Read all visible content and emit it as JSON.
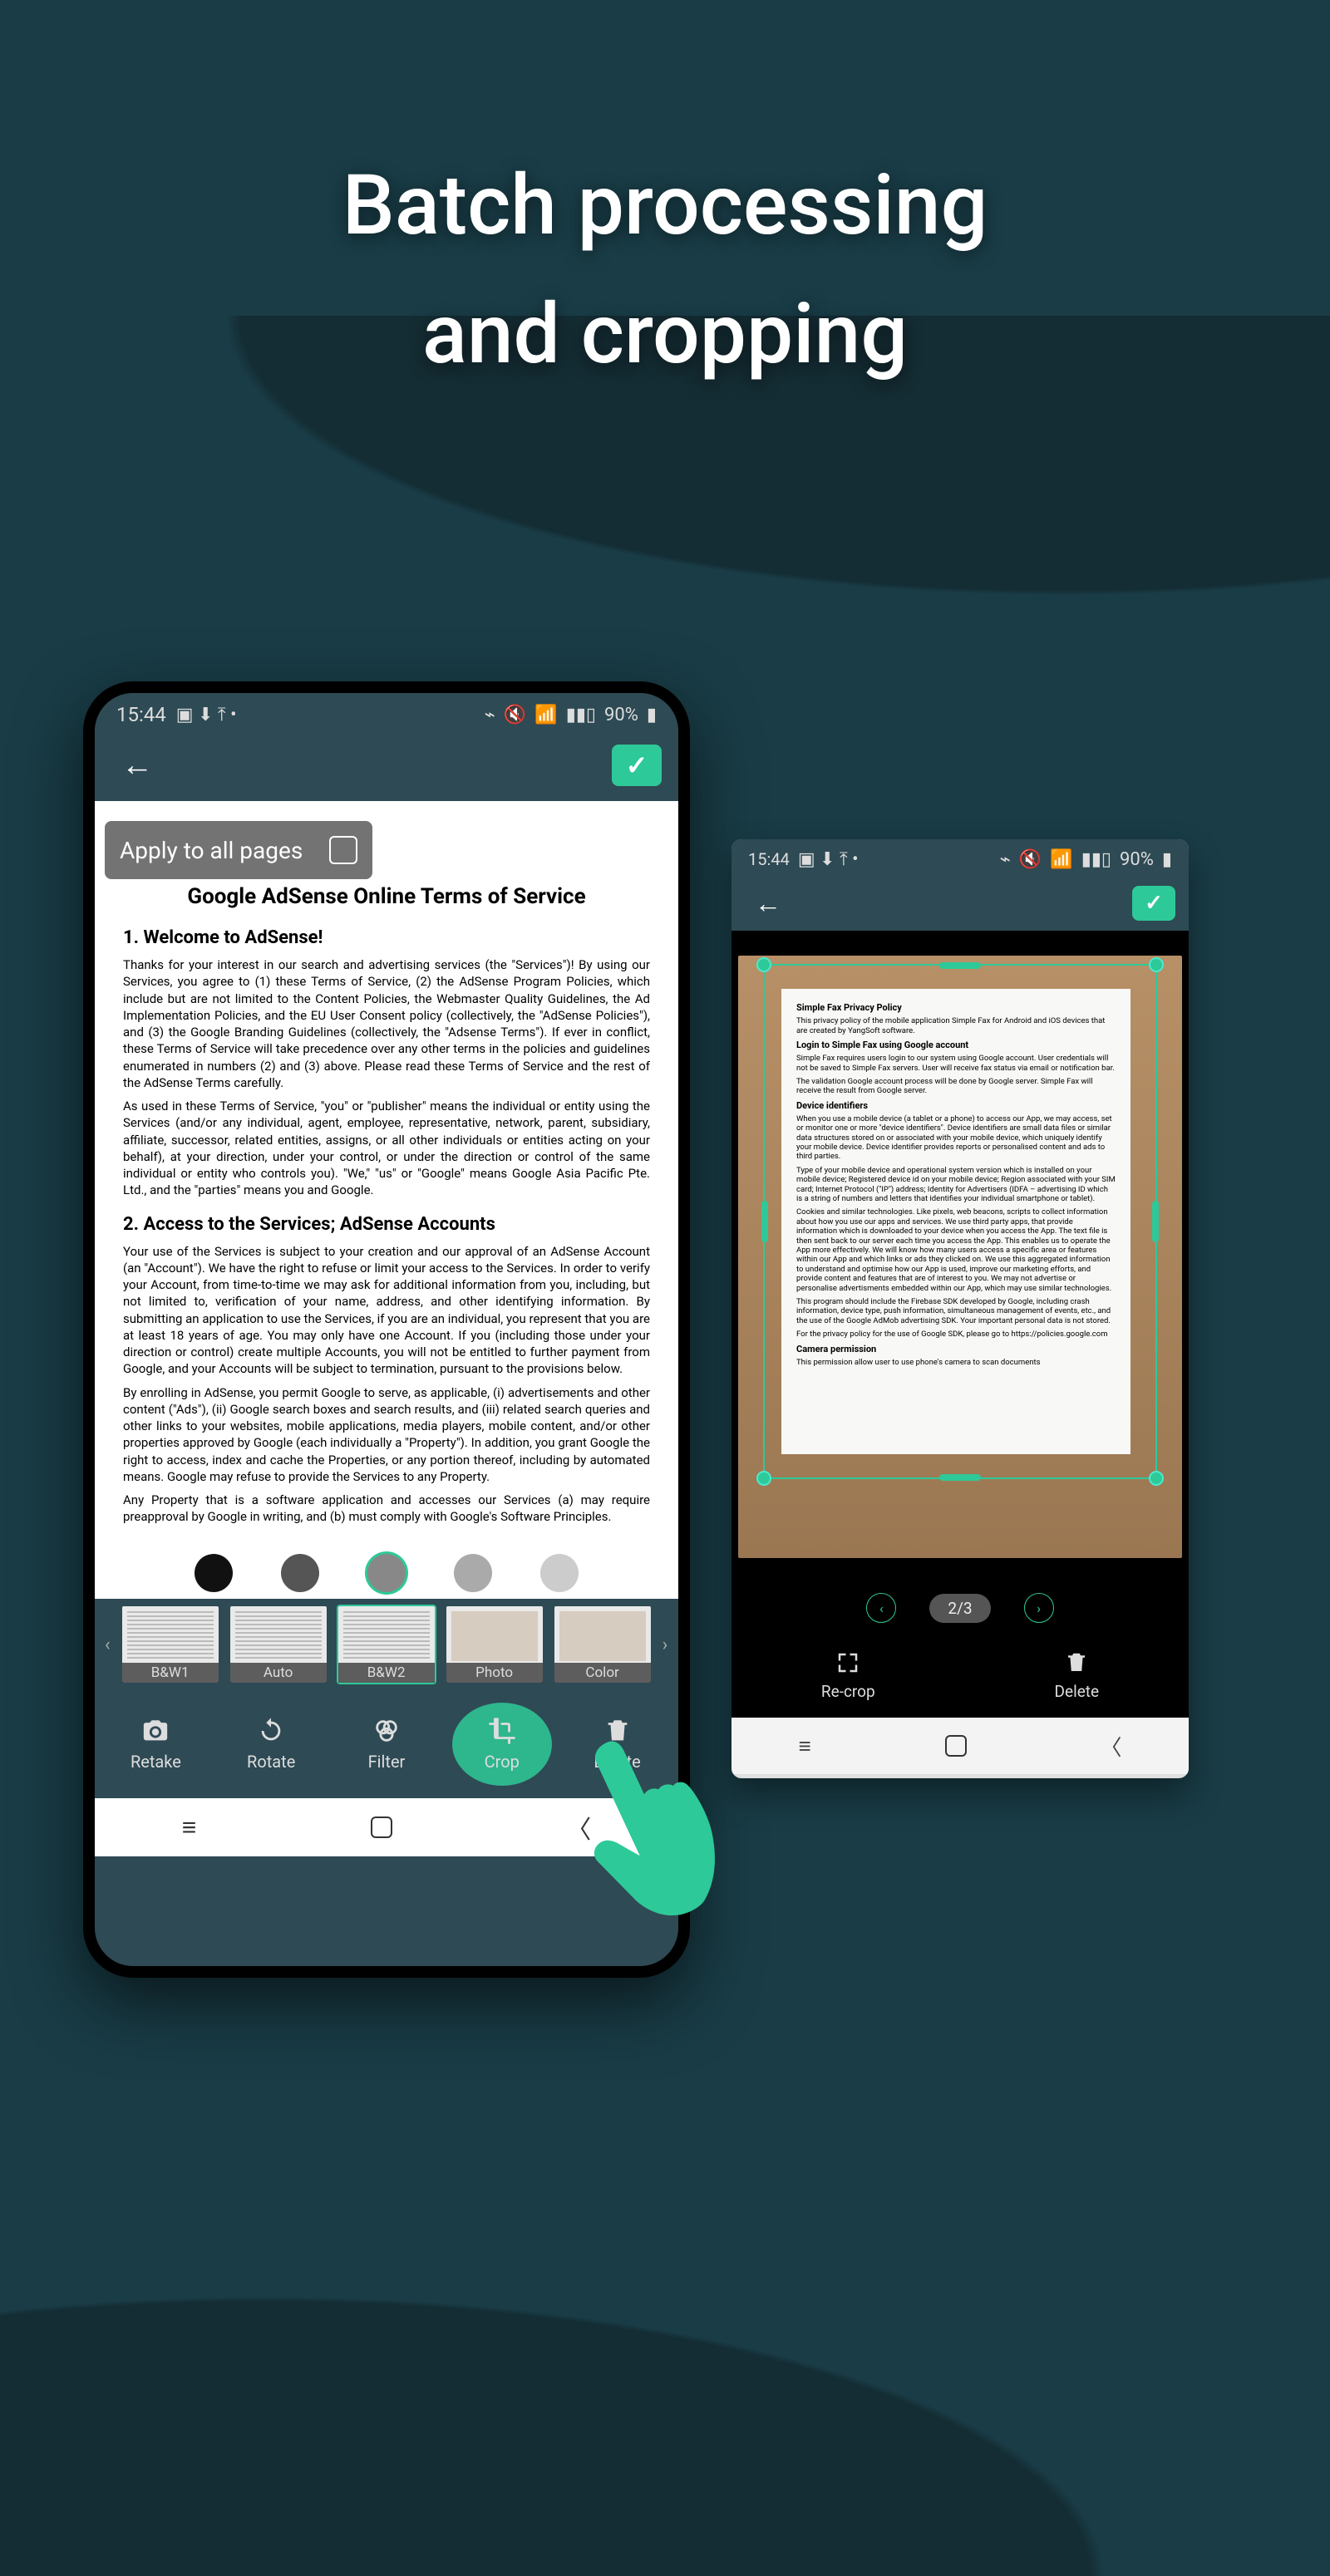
{
  "promo": {
    "heading_line1": "Batch processing",
    "heading_line2": "and cropping"
  },
  "phone1": {
    "status": {
      "time": "15:44",
      "battery": "90%"
    },
    "apply_label": "Apply to all pages",
    "document": {
      "title": "Google AdSense Online Terms of Service",
      "sec1_head": "1.   Welcome to AdSense!",
      "sec1_p1": "Thanks for your interest in our search and advertising services (the \"Services\")! By using our Services, you agree to (1) these Terms of Service, (2) the AdSense Program Policies, which include but are not limited to the Content Policies, the Webmaster Quality Guidelines, the Ad Implementation Policies, and the EU User Consent policy (collectively, the \"AdSense Policies\"), and (3) the Google Branding Guidelines (collectively, the \"Adsense Terms\"). If ever in conflict, these Terms of Service will take precedence over any other terms in the policies and guidelines enumerated in numbers (2) and (3) above. Please read these Terms of Service and the rest of the AdSense Terms carefully.",
      "sec1_p2": "As used in these Terms of Service, \"you\" or \"publisher\" means the individual or entity using the Services (and/or any individual, agent, employee, representative, network, parent, subsidiary, affiliate, successor, related entities, assigns, or all other individuals or entities acting on your behalf), at your direction, under your control, or under the direction or control of the same individual or entity who controls you). \"We,\" \"us\" or \"Google\" means Google Asia Pacific Pte. Ltd., and the \"parties\" means you and Google.",
      "sec2_head": "2. Access to the Services; AdSense Accounts",
      "sec2_p1": "Your use of the Services is subject to your creation and our approval of an AdSense Account (an \"Account\"). We have the right to refuse or limit your access to the Services. In order to verify your Account, from time-to-time we may ask for additional information from you, including, but not limited to, verification of your name, address, and other identifying information. By submitting an application to use the Services, if you are an individual, you represent that you are at least 18 years of age. You may only have one Account. If you (including those under your direction or control) create multiple Accounts, you will not be entitled to further payment from Google, and your Accounts will be subject to termination, pursuant to the provisions below.",
      "sec2_p2": "By enrolling in AdSense, you permit Google to serve, as applicable, (i) advertisements and other content (\"Ads\"), (ii) Google search boxes and search results, and (iii) related search queries and other links to your websites, mobile applications, media players, mobile content, and/or other properties approved by Google (each individually a \"Property\"). In addition, you grant Google the right to access, index and cache the Properties, or any portion thereof, including by automated means. Google may refuse to provide the Services to any Property.",
      "sec2_p3": "Any Property that is a software application and accesses our Services (a) may require preapproval by Google in writing, and (b) must comply with Google's Software Principles."
    },
    "filters": [
      "B&W1",
      "Auto",
      "B&W2",
      "Photo",
      "Color"
    ],
    "filter_active_index": 2,
    "tools": {
      "retake": "Retake",
      "rotate": "Rotate",
      "filter": "Filter",
      "crop": "Crop",
      "delete": "Delete"
    },
    "tool_active": "crop"
  },
  "phone2": {
    "status": {
      "time": "15:44",
      "battery": "90%"
    },
    "pager": "2/3",
    "doc": {
      "h1": "Simple Fax Privacy Policy",
      "p1": "This privacy policy of the mobile application Simple Fax for Android and iOS devices that are created by YangSoft software.",
      "h2": "Login to Simple Fax using Google account",
      "p2": "Simple Fax requires users login to our system using Google account. User credentials will not be saved to Simple Fax servers. User will receive fax status via email or notification bar.",
      "p3": "The validation Google account process will be done by Google server. Simple Fax will receive the result from Google server.",
      "h3": "Device identifiers",
      "p4": "When you use a mobile device (a tablet or a phone) to access our App, we may access, set or monitor one or more \"device identifiers\". Device identifiers are small data files or similar data structures stored on or associated with your mobile device, which uniquely identify your mobile device. Device identifier provides reports or personalised content and ads to third parties.",
      "p5": "Type of your mobile device and operational system version which is installed on your mobile device; Registered device id on your mobile device; Region associated with your SIM card; Internet Protocol (\"IP\") address; Identity for Advertisers (IDFA – advertising ID which is a string of numbers and letters that identifies your individual smartphone or tablet).",
      "p6": "Cookies and similar technologies. Like pixels, web beacons, scripts to collect information about how you use our apps and services. We use third party apps, that provide information which is downloaded to your device when you access the App. The text file is then sent back to our server each time you access the App. This enables us to operate the App more effectively. We will know how many users access a specific area or features within our App and which links or ads they clicked on. We use this aggregated information to understand and optimise how our App is used, improve our marketing efforts, and provide content and features that are of interest to you. We may not advertise or personalise advertisments embedded within our App, which may use similar technologies.",
      "p7": "This program should include the Firebase SDK developed by Google, including crash information, device type, push information, simultaneous management of events, etc., and the use of the Google AdMob advertising SDK. Your important personal data is not stored.",
      "p8": "For the privacy policy for the use of Google SDK, please go to https://policies.google.com",
      "h4": "Camera permission",
      "p9": "This permission allow user to use phone's camera to scan documents"
    },
    "tools": {
      "recrop": "Re-crop",
      "delete": "Delete"
    }
  }
}
